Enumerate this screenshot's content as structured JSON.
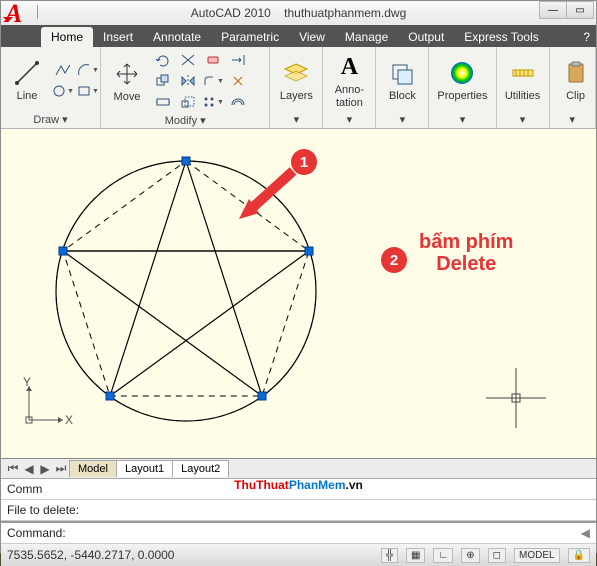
{
  "title": {
    "app": "AutoCAD 2010",
    "file": "thuthuatphanmem.dwg"
  },
  "tabs": [
    "Home",
    "Insert",
    "Annotate",
    "Parametric",
    "View",
    "Manage",
    "Output",
    "Express Tools"
  ],
  "active_tab": "Home",
  "panels": {
    "draw": {
      "label": "Draw ▾",
      "line": "Line"
    },
    "modify": {
      "label": "Modify ▾",
      "move": "Move"
    },
    "layers": {
      "label": "▾",
      "big": "Layers"
    },
    "annot": {
      "label": "▾",
      "big": "Anno-\ntation"
    },
    "block": {
      "label": "▾",
      "big": "Block"
    },
    "props": {
      "label": "▾",
      "big": "Properties"
    },
    "util": {
      "label": "▾",
      "big": "Utilities"
    },
    "clip": {
      "label": "▾",
      "big": "Clip"
    }
  },
  "canvas": {
    "callout1": "1",
    "callout2": "2",
    "callout_text": "bấm phím\nDelete"
  },
  "layout_tabs": {
    "model": "Model",
    "l1": "Layout1",
    "l2": "Layout2"
  },
  "cmd": {
    "l1": "Comm",
    "l2": "File to delete:",
    "l3": "Command:"
  },
  "status": {
    "coords": "7535.5652, -5440.2717, 0.0000",
    "model": "MODEL"
  },
  "watermark": {
    "a": "ThuThuat",
    "b": "PhanMem",
    "c": ".vn"
  },
  "colors": {
    "wm_a": "#e30000",
    "wm_b": "#0077cc",
    "wm_c": "#111"
  }
}
